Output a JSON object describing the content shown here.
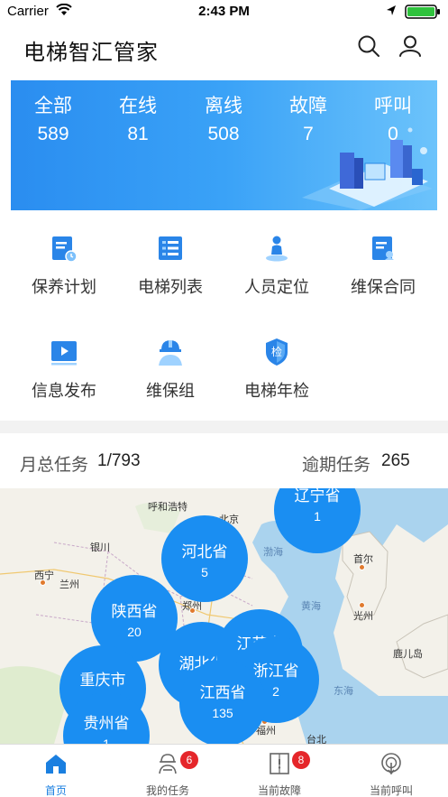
{
  "status_bar": {
    "carrier": "Carrier",
    "time": "2:43 PM"
  },
  "header": {
    "title": "电梯智汇管家",
    "icons": [
      "search-icon",
      "user-icon"
    ]
  },
  "summary": [
    {
      "label": "全部",
      "value": "589"
    },
    {
      "label": "在线",
      "value": "81"
    },
    {
      "label": "离线",
      "value": "508"
    },
    {
      "label": "故障",
      "value": "7"
    },
    {
      "label": "呼叫",
      "value": "0"
    }
  ],
  "menu": [
    {
      "label": "保养计划",
      "icon": "maintenance-plan-icon"
    },
    {
      "label": "电梯列表",
      "icon": "elevator-list-icon"
    },
    {
      "label": "人员定位",
      "icon": "person-location-icon"
    },
    {
      "label": "维保合同",
      "icon": "contract-icon"
    },
    {
      "label": "信息发布",
      "icon": "publish-icon"
    },
    {
      "label": "维保组",
      "icon": "team-icon"
    },
    {
      "label": "电梯年检",
      "icon": "annual-inspection-icon"
    }
  ],
  "tasks": {
    "monthly_label": "月总任务",
    "monthly_value": "1/793",
    "overdue_label": "逾期任务",
    "overdue_value": "265"
  },
  "map": {
    "places": [
      "呼和浩特",
      "北京",
      "银川",
      "西宁",
      "兰州",
      "郑州",
      "渤海",
      "首尔",
      "黄海",
      "光州",
      "东海",
      "鹿儿岛",
      "福州",
      "台北"
    ],
    "clusters": [
      {
        "name": "辽宁省",
        "count": "1"
      },
      {
        "name": "河北省",
        "count": "5"
      },
      {
        "name": "陕西省",
        "count": "20"
      },
      {
        "name": "湖北省",
        "count": ""
      },
      {
        "name": "江苏省",
        "count": ""
      },
      {
        "name": "浙江省",
        "count": "2"
      },
      {
        "name": "江西省",
        "count": "135"
      },
      {
        "name": "重庆市",
        "count": ""
      },
      {
        "name": "贵州省",
        "count": "1"
      }
    ]
  },
  "tabbar": [
    {
      "label": "首页",
      "badge": ""
    },
    {
      "label": "我的任务",
      "badge": "6"
    },
    {
      "label": "当前故障",
      "badge": "8"
    },
    {
      "label": "当前呼叫",
      "badge": ""
    }
  ],
  "colors": {
    "accent": "#1a8ef2",
    "badge": "#e5262a",
    "banner_start": "#2a8df0",
    "banner_end": "#6cc3fb"
  }
}
